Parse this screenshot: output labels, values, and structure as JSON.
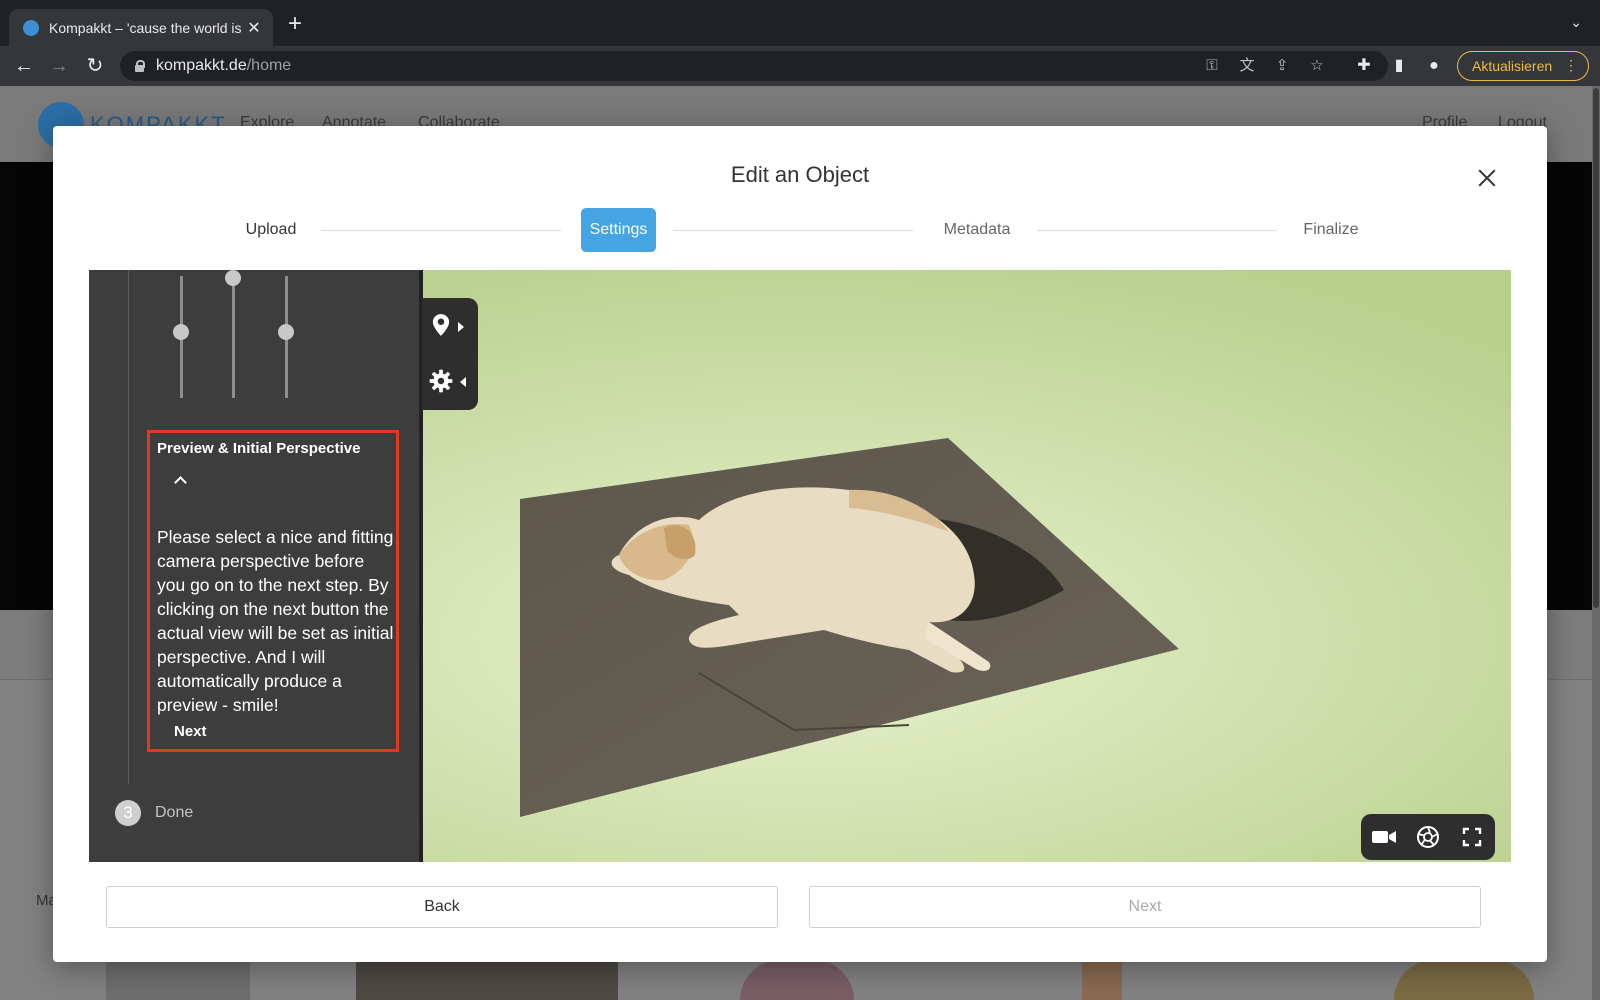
{
  "browser": {
    "tab_title": "Kompakkt – 'cause the world is",
    "url_host": "kompakkt.de",
    "url_path": "/home",
    "update_label": "Aktualisieren"
  },
  "site": {
    "logo_text": "KOMPAKKT",
    "nav": [
      "Explore",
      "Annotate",
      "Collaborate"
    ],
    "nav_right": [
      "Profile",
      "Logout"
    ],
    "left_edge_text": "Ma"
  },
  "modal": {
    "title": "Edit an Object",
    "steps": [
      {
        "label": "Upload",
        "state": "done"
      },
      {
        "label": "Settings",
        "state": "active"
      },
      {
        "label": "Metadata",
        "state": "upcoming"
      },
      {
        "label": "Finalize",
        "state": "upcoming"
      }
    ],
    "back_label": "Back",
    "next_label": "Next"
  },
  "settings_panel": {
    "sliders": [
      0.55,
      0.0,
      0.55
    ],
    "tip": {
      "heading": "Preview & Initial Perspective",
      "text": "Please select a nice and fitting camera perspective before you go on to the next step. By clicking on the next button the actual view will be set as initial perspective. And I will automatically produce a preview - smile!",
      "next_label": "Next"
    },
    "done_step": {
      "number": "3",
      "label": "Done"
    }
  },
  "viewer": {
    "background_color": "#c5d9a0",
    "dock_icons": [
      "map-pin-icon",
      "gear-icon"
    ],
    "controls": [
      "camera-icon",
      "aperture-icon",
      "fullscreen-icon"
    ]
  },
  "colors": {
    "accent": "#45a4e2",
    "highlight": "#e03a1c",
    "update": "#f2b84b"
  }
}
